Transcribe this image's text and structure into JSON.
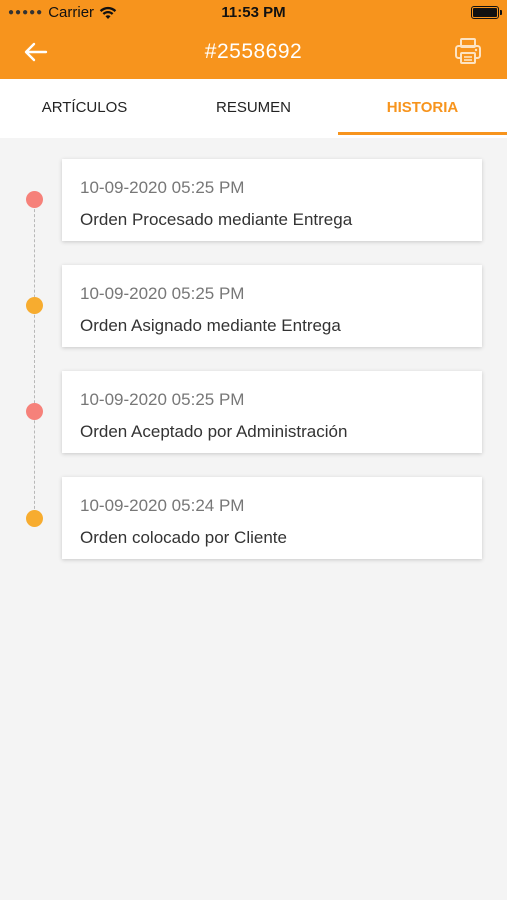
{
  "status_bar": {
    "carrier": "Carrier",
    "time": "11:53 PM",
    "signal_icon": "signal-dots-icon",
    "wifi_icon": "wifi-icon",
    "battery_icon": "battery-icon"
  },
  "header": {
    "title": "#2558692",
    "back_icon": "arrow-left-icon",
    "print_icon": "printer-icon",
    "color": "#f7941d"
  },
  "tabs": [
    {
      "label": "ARTÍCULOS",
      "active": false
    },
    {
      "label": "RESUMEN",
      "active": false
    },
    {
      "label": "HISTORIA",
      "active": true
    }
  ],
  "history": [
    {
      "date": "10-09-2020 05:25 PM",
      "description": "Orden Procesado mediante Entrega",
      "dot_color": "#f6817a"
    },
    {
      "date": "10-09-2020 05:25 PM",
      "description": "Orden Asignado mediante Entrega",
      "dot_color": "#f7ac2f"
    },
    {
      "date": "10-09-2020 05:25 PM",
      "description": "Orden Aceptado por Administración",
      "dot_color": "#f6817a"
    },
    {
      "date": "10-09-2020 05:24 PM",
      "description": "Orden colocado por Cliente",
      "dot_color": "#f7ac2f"
    }
  ]
}
